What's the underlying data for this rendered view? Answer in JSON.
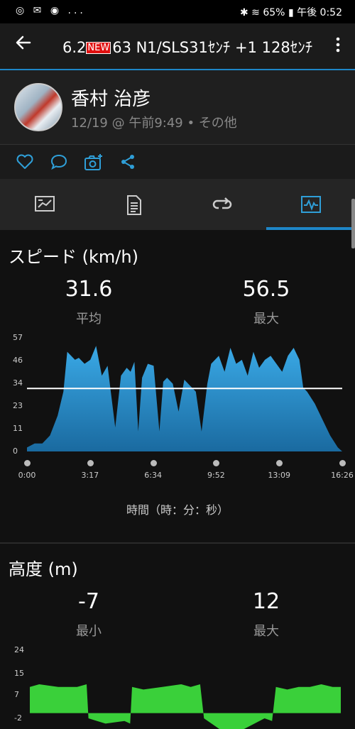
{
  "status_bar": {
    "left_icons": "◎ ✉ ◉ ...",
    "battery": "65%",
    "time": "午後 0:52"
  },
  "app_bar": {
    "title_pre": "6.2",
    "new_badge": "NEW",
    "title_post": "63 N1/SLS31ｾﾝﾁ  +1 128ｾﾝﾁ"
  },
  "user": {
    "name": "香村 治彦",
    "date": "12/19 @ 午前9:49 • その他"
  },
  "speed": {
    "title": "スピード (km/h)",
    "avg_value": "31.6",
    "avg_label": "平均",
    "max_value": "56.5",
    "max_label": "最大",
    "axis_title": "時間（時：分：秒）"
  },
  "altitude": {
    "title": "高度 (m)",
    "min_value": "-7",
    "min_label": "最小",
    "max_value": "12",
    "max_label": "最大"
  },
  "chart_data": [
    {
      "type": "area",
      "title": "スピード (km/h)",
      "xlabel": "時間（時：分：秒）",
      "ylabel": "",
      "y_ticks": [
        "57",
        "46",
        "34",
        "23",
        "11",
        "0"
      ],
      "x_ticks": [
        "0:00",
        "3:17",
        "6:34",
        "9:52",
        "13:09",
        "16:26"
      ],
      "ylim": [
        0,
        57
      ],
      "average_line": 31.6,
      "fill_color": "#2f9fd8",
      "x": [
        0,
        0.4,
        0.8,
        1.2,
        1.6,
        1.9,
        2.1,
        2.3,
        2.5,
        2.7,
        3.0,
        3.3,
        3.6,
        3.9,
        4.2,
        4.6,
        4.9,
        5.2,
        5.4,
        5.6,
        5.8,
        6.0,
        6.3,
        6.6,
        6.9,
        7.1,
        7.3,
        7.6,
        7.9,
        8.2,
        8.5,
        8.8,
        9.1,
        9.4,
        9.6,
        9.8,
        10.0,
        10.3,
        10.6,
        10.9,
        11.2,
        11.5,
        11.8,
        12.1,
        12.4,
        12.7,
        13.0,
        13.3,
        13.6,
        13.9,
        14.2,
        14.4,
        14.6,
        15.0,
        15.4,
        15.8,
        16.2,
        16.43
      ],
      "values": [
        2,
        4,
        4,
        8,
        18,
        30,
        50,
        48,
        46,
        47,
        44,
        46,
        53,
        38,
        43,
        12,
        38,
        42,
        40,
        45,
        10,
        37,
        44,
        43,
        10,
        35,
        37,
        34,
        20,
        36,
        33,
        30,
        10,
        34,
        44,
        46,
        48,
        40,
        52,
        44,
        46,
        38,
        50,
        42,
        46,
        48,
        44,
        40,
        48,
        52,
        46,
        32,
        30,
        24,
        16,
        8,
        2,
        0
      ]
    },
    {
      "type": "area",
      "title": "高度 (m)",
      "xlabel": "",
      "ylabel": "",
      "y_ticks": [
        "24",
        "15",
        "7",
        "-2"
      ],
      "ylim": [
        -2,
        24
      ],
      "partial": true,
      "fill_color": "#3ad03a",
      "x": [
        0,
        0.5,
        1.5,
        2.5,
        3.0,
        3.1,
        4.0,
        5.0,
        5.3,
        5.4,
        6.0,
        7.0,
        8.0,
        8.5,
        9.0,
        9.2,
        10.0,
        10.8,
        11.6,
        12.4,
        12.8,
        13.0,
        13.6,
        14.2,
        14.8,
        15.4,
        16.0,
        16.43
      ],
      "values": [
        10,
        11,
        10,
        10,
        11,
        -2,
        -4,
        -3,
        -4,
        10,
        9,
        10,
        11,
        10,
        11,
        -2,
        -6,
        -8,
        -5,
        -2,
        -3,
        10,
        9,
        10,
        10,
        11,
        10,
        10
      ]
    }
  ]
}
